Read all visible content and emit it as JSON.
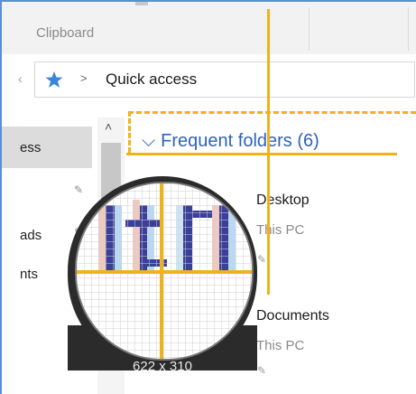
{
  "ribbon": {
    "group_label": "Clipboard"
  },
  "address": {
    "path_root_icon": "pin-star-icon",
    "path_separator": ">",
    "path_text": "Quick access"
  },
  "nav": {
    "items": [
      {
        "label": "ess"
      },
      {
        "label": "ads"
      },
      {
        "label": "nts"
      }
    ]
  },
  "section": {
    "title": "Frequent folders (6)"
  },
  "folders": [
    {
      "name": "Desktop",
      "location": "This PC"
    },
    {
      "name": "Documents",
      "location": "This PC"
    }
  ],
  "magnifier": {
    "size_readout": "622 x 310"
  },
  "colors": {
    "guide": "#f0b21a",
    "accent": "#2e63b8",
    "frame": "#5a8fd6"
  }
}
